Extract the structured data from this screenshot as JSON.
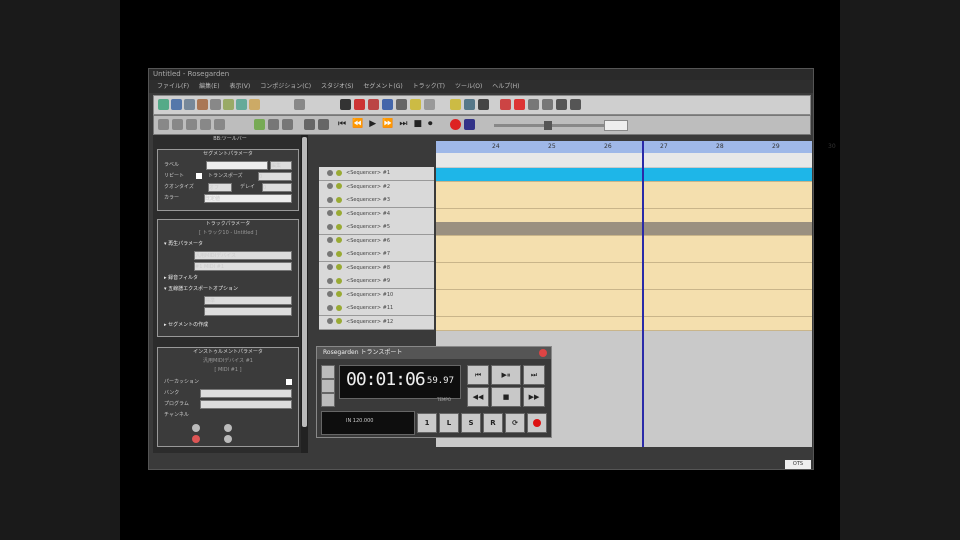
{
  "window": {
    "title": "Untitled - Rosegarden"
  },
  "menu": [
    "ファイル(F)",
    "編集(E)",
    "表示(V)",
    "コンポジション(C)",
    "スタジオ(S)",
    "セグメント(G)",
    "トラック(T)",
    "ツール(O)",
    "ヘルプ(H)"
  ],
  "panel": {
    "header": "BB:ツールバー",
    "segment_params": {
      "title": "セグメントパラメータ",
      "rows": [
        {
          "label": "ラベル",
          "value": "",
          "btn": "編集"
        },
        {
          "label": "リピート",
          "value": "トランスポーズ",
          "select": "0"
        },
        {
          "label": "クオンタイズ",
          "value": "オフ",
          "select2": "デレイ",
          "value2": "0"
        },
        {
          "label": "カラー",
          "value": "既定値"
        }
      ]
    },
    "track_params": {
      "title": "トラックパラメータ",
      "subtitle": "[ トラック10 - Untitled ]",
      "items": [
        "再生パラメータ",
        "録音フィルタ",
        "五線譜エクスポートオプション",
        "セグメントの作成"
      ],
      "device": "汎用MIDIデバイス",
      "instrument": "#1 MIDI #1",
      "staff_size": "標準",
      "staff_type": "-"
    },
    "instrument_params": {
      "title": "インストゥルメントパラメータ",
      "subtitle": "汎用MIDIデバイス #1",
      "label1": "[ MIDI #1 ]",
      "rows": [
        "パーカッション",
        "バンク",
        "プログラム",
        "チャンネル"
      ]
    }
  },
  "tracks": [
    "<Sequencer> #1",
    "<Sequencer> #2",
    "<Sequencer> #3",
    "<Sequencer> #4",
    "<Sequencer> #5",
    "<Sequencer> #6",
    "<Sequencer> #7",
    "<Sequencer> #8",
    "<Sequencer> #9",
    "<Sequencer> #10",
    "<Sequencer> #11",
    "<Sequencer> #12"
  ],
  "ruler": [
    "24",
    "25",
    "26",
    "27",
    "28",
    "29",
    "30"
  ],
  "transport": {
    "title": "Rosegarden トランスポート",
    "time_main": "00:01:06",
    "time_frac": "59.97",
    "tempo_label": "TEMPO",
    "bottom_left": "IN 120.000",
    "buttons": [
      "1",
      "L",
      "S",
      "R"
    ]
  },
  "corner_label": "OTS"
}
